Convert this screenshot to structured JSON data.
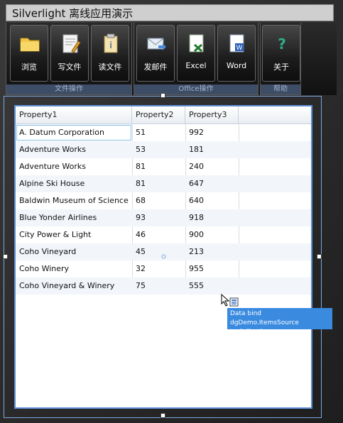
{
  "window": {
    "title": "Silverlight 离线应用演示"
  },
  "ribbon": {
    "groups": [
      {
        "label": "文件操作",
        "buttons": [
          {
            "label": "浏览",
            "icon": "folder-icon"
          },
          {
            "label": "写文件",
            "icon": "write-file-icon"
          },
          {
            "label": "读文件",
            "icon": "read-file-icon"
          }
        ]
      },
      {
        "label": "Office操作",
        "buttons": [
          {
            "label": "发邮件",
            "icon": "mail-icon"
          },
          {
            "label": "Excel",
            "icon": "excel-icon"
          },
          {
            "label": "Word",
            "icon": "word-icon"
          }
        ]
      },
      {
        "label": "帮助",
        "buttons": [
          {
            "label": "关于",
            "icon": "help-icon"
          }
        ]
      }
    ]
  },
  "datagrid": {
    "columns": [
      "Property1",
      "Property2",
      "Property3"
    ],
    "rows": [
      [
        "A. Datum Corporation",
        "51",
        "992"
      ],
      [
        "Adventure Works",
        "53",
        "181"
      ],
      [
        "Adventure Works",
        "81",
        "240"
      ],
      [
        "Alpine Ski House",
        "81",
        "647"
      ],
      [
        "Baldwin Museum of Science",
        "68",
        "640"
      ],
      [
        "Blue Yonder Airlines",
        "93",
        "918"
      ],
      [
        "City Power & Light",
        "46",
        "900"
      ],
      [
        "Coho Vineyard",
        "45",
        "213"
      ],
      [
        "Coho Winery",
        "32",
        "955"
      ],
      [
        "Coho Vineyard & Winery",
        "75",
        "555"
      ]
    ]
  },
  "tooltip": {
    "line1": "Data bind dgDemo.ItemsSource",
    "line2": "to Collection"
  },
  "colors": {
    "accent": "#3a8ae0",
    "grid_border": "#5c8fd6",
    "group_label_bg": "#3e4d66"
  }
}
